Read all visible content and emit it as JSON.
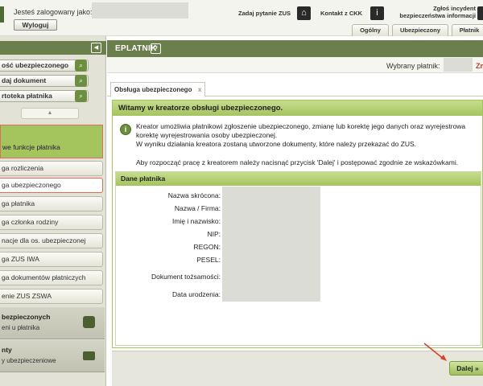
{
  "topbar": {
    "login_label": "Jesteś zalogowany jako:",
    "logout_label": "Wyloguj",
    "ask_zus_label": "Zadaj pytanie ZUS",
    "contact_label": "Kontakt z CKK",
    "incident_line1": "Zgłoś incydent",
    "incident_line2": "bezpieczeństwa informacji",
    "tabs": [
      "Ogólny",
      "Ubezpieczony",
      "Płatnik"
    ]
  },
  "sidebar": {
    "search_items": [
      "ość ubezpieczonego",
      "daj dokument",
      "rtoteka płatnika"
    ],
    "scroll_up": "▲",
    "new_functions_label": "we funkcje płatnika",
    "menu_items": [
      "ga rozliczenia",
      "ga ubezpieczonego",
      "ga płatnika",
      "ga członka rodziny",
      "nacje dla os. ubezpieczonej",
      "ga ZUS IWA",
      "ga dokumentów płatniczych",
      "enie ZUS ZSWA"
    ],
    "groups": [
      {
        "title": "bezpieczonych",
        "sub": "eni u płatnika",
        "icon": "people-icon"
      },
      {
        "title": "nty",
        "sub": "y ubezpieczeniowe",
        "icon": "folder-icon"
      }
    ]
  },
  "main": {
    "title": "EPLATNIK",
    "help_icon": "?",
    "payer_label": "Wybrany płatnik:",
    "payer_fragment": "Zm",
    "tab_label": "Obsługa ubezpieczonego",
    "tab_close": "x",
    "wizard": {
      "heading": "Witamy w kreatorze obsługi ubezpieczonego.",
      "lines": [
        "Kreator umożliwia płatnikowi zgłoszenie ubezpieczonego, zmianę lub korektę jego danych oraz wyrejestrowa",
        "korektę wyrejestrowania osoby ubezpieczonej.",
        "W wyniku działania kreatora zostaną utworzone dokumenty, które należy przekazać do ZUS."
      ],
      "instruction": "Aby rozpocząć pracę z kreatorem należy nacisnąć przycisk 'Dalej' i postępować zgodnie ze wskazówkami."
    },
    "dane_platnika": {
      "heading": "Dane płatnika",
      "fields": [
        "Nazwa skrócona:",
        "Nazwa / Firma:",
        "Imię i nazwisko:",
        "NIP:",
        "REGON:",
        "PESEL:",
        "Dokument tożsamości:",
        "Data urodzenia:"
      ]
    },
    "next_button": "Dalej »"
  },
  "colors": {
    "header_green": "#6b7f4c",
    "panel_green": "#a4c45e",
    "highlight_red": "#e06a55",
    "annotation_arrow": "#d9402b"
  }
}
